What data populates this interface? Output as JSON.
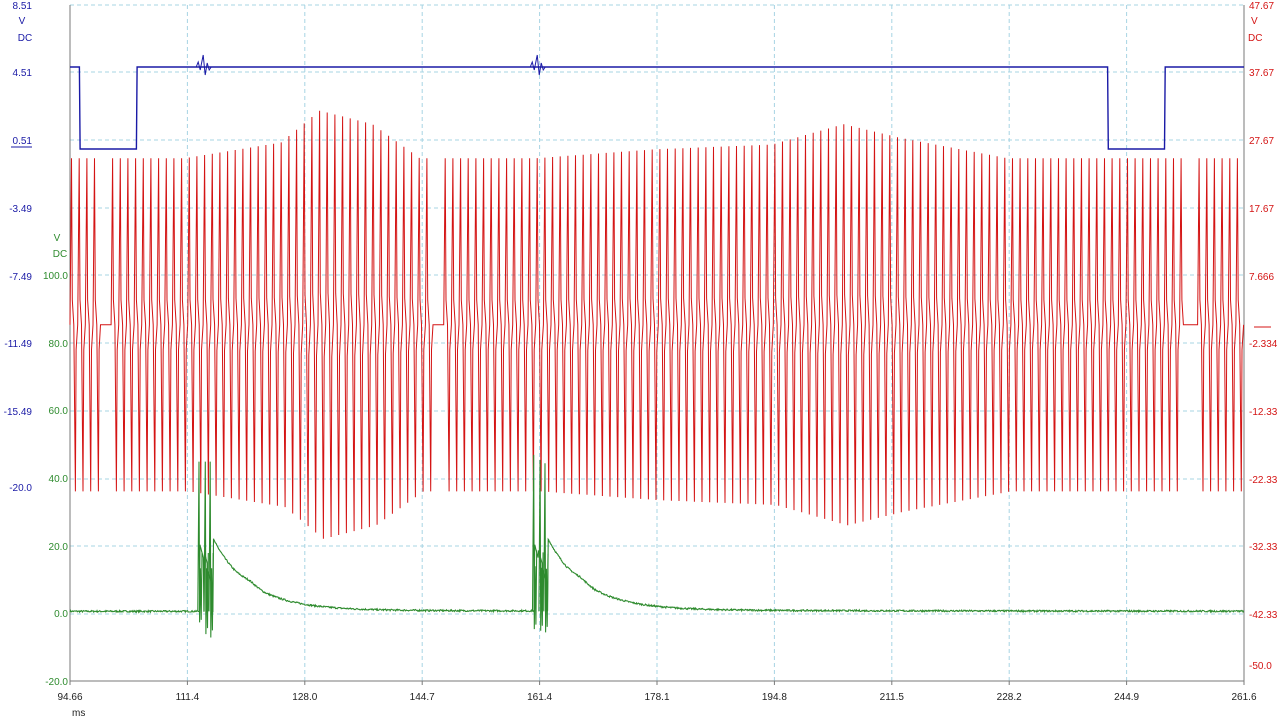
{
  "chart_data": {
    "type": "line",
    "title": "",
    "x_axis": {
      "unit": "ms",
      "range": [
        94.66,
        261.6
      ],
      "ticks": [
        "94.66",
        "111.4",
        "128.0",
        "144.7",
        "161.4",
        "178.1",
        "194.8",
        "211.5",
        "228.2",
        "244.9",
        "261.6"
      ]
    },
    "axes": {
      "blue_left": {
        "color": "#1a1aa6",
        "unit": [
          "V",
          "DC"
        ],
        "ticks": [
          "8.51",
          "4.51",
          "0.51",
          "-3.49",
          "-7.49",
          "-11.49",
          "-15.49",
          "-20.0"
        ]
      },
      "green_left": {
        "color": "#2e8b2e",
        "unit": [
          "V",
          "DC"
        ],
        "ticks": [
          "100.0",
          "80.0",
          "60.0",
          "40.0",
          "20.0",
          "0.0",
          "-20.0"
        ]
      },
      "red_right": {
        "color": "#d41414",
        "unit": [
          "V",
          "DC"
        ],
        "ticks": [
          "47.67",
          "37.67",
          "27.67",
          "17.67",
          "7.666",
          "-2.334",
          "-12.33",
          "-22.33",
          "-32.33",
          "-42.33",
          "-50.0"
        ]
      }
    },
    "grid": true,
    "legend": "none",
    "series": [
      {
        "color": "#1a1aa6",
        "shape": "square",
        "levels": {
          "high": 4.51,
          "low": 0.51
        },
        "points": [
          [
            94.66,
            4.51
          ],
          [
            96.0,
            4.51
          ],
          [
            96.1,
            0.51
          ],
          [
            104.1,
            0.51
          ],
          [
            104.2,
            4.51
          ],
          [
            242.2,
            4.51
          ],
          [
            242.3,
            0.51
          ],
          [
            250.3,
            0.51
          ],
          [
            250.4,
            4.51
          ],
          [
            261.6,
            4.51
          ]
        ],
        "spikes_ms": [
          113.6,
          161.1
        ]
      },
      {
        "color": "#d41414",
        "shape": "oscillation",
        "offset": 0.5,
        "period_ms": 1.09,
        "segments": [
          {
            "start": 94.66,
            "end": 99.0,
            "envelope": [
              [
                94.66,
                24.5
              ],
              [
                99.0,
                24.5
              ]
            ]
          },
          {
            "start": 99.0,
            "end": 100.5,
            "flat": 0.5
          },
          {
            "start": 100.5,
            "end": 146.4,
            "envelope": [
              [
                100.5,
                24.5
              ],
              [
                111.4,
                24.5
              ],
              [
                125.0,
                26.8
              ],
              [
                130.5,
                31.5
              ],
              [
                138.0,
                29.5
              ],
              [
                144.7,
                24.5
              ],
              [
                146.4,
                24.5
              ]
            ]
          },
          {
            "start": 146.4,
            "end": 147.8,
            "flat": 0.5
          },
          {
            "start": 147.8,
            "end": 253.0,
            "envelope": [
              [
                147.8,
                24.5
              ],
              [
                161.4,
                24.5
              ],
              [
                178.1,
                25.8
              ],
              [
                194.8,
                26.5
              ],
              [
                205.0,
                29.5
              ],
              [
                213.0,
                27.5
              ],
              [
                228.2,
                24.5
              ],
              [
                238.0,
                24.5
              ],
              [
                253.0,
                24.5
              ]
            ]
          },
          {
            "start": 253.0,
            "end": 255.0,
            "flat": 0.5
          },
          {
            "start": 255.0,
            "end": 261.6,
            "envelope": [
              [
                255.0,
                24.5
              ],
              [
                261.6,
                24.5
              ]
            ]
          }
        ]
      },
      {
        "color": "#2e8b2e",
        "shape": "pulses",
        "baseline": 0.8,
        "bursts": [
          {
            "center": 130.6,
            "spikes": [
              {
                "t": 113.0,
                "hi": 45.5,
                "lo": -2.5
              },
              {
                "t": 113.9,
                "hi": 45.5,
                "lo": -6.0
              },
              {
                "t": 114.6,
                "hi": 45.5,
                "lo": -7.0
              }
            ],
            "bumps": [
              [
                113.1,
                21.0
              ],
              [
                113.7,
                19.0
              ],
              [
                114.3,
                13.0
              ]
            ],
            "decay": {
              "start": 115.0,
              "peak": 22.5,
              "tau_ms": 5.3,
              "floor": 1.2
            }
          },
          {
            "center": 177.8,
            "spikes": [
              {
                "t": 160.6,
                "hi": 47.5,
                "lo": -4.5
              },
              {
                "t": 161.5,
                "hi": 46.0,
                "lo": -5.0
              },
              {
                "t": 162.2,
                "hi": 45.0,
                "lo": -5.5
              }
            ],
            "bumps": [
              [
                160.7,
                21.0
              ],
              [
                161.3,
                19.0
              ],
              [
                161.9,
                13.5
              ]
            ],
            "decay": {
              "start": 162.6,
              "peak": 22.5,
              "tau_ms": 5.3,
              "floor": 1.2
            }
          }
        ],
        "small_bumps_ms": [
          120.2,
          167.3
        ]
      }
    ]
  }
}
